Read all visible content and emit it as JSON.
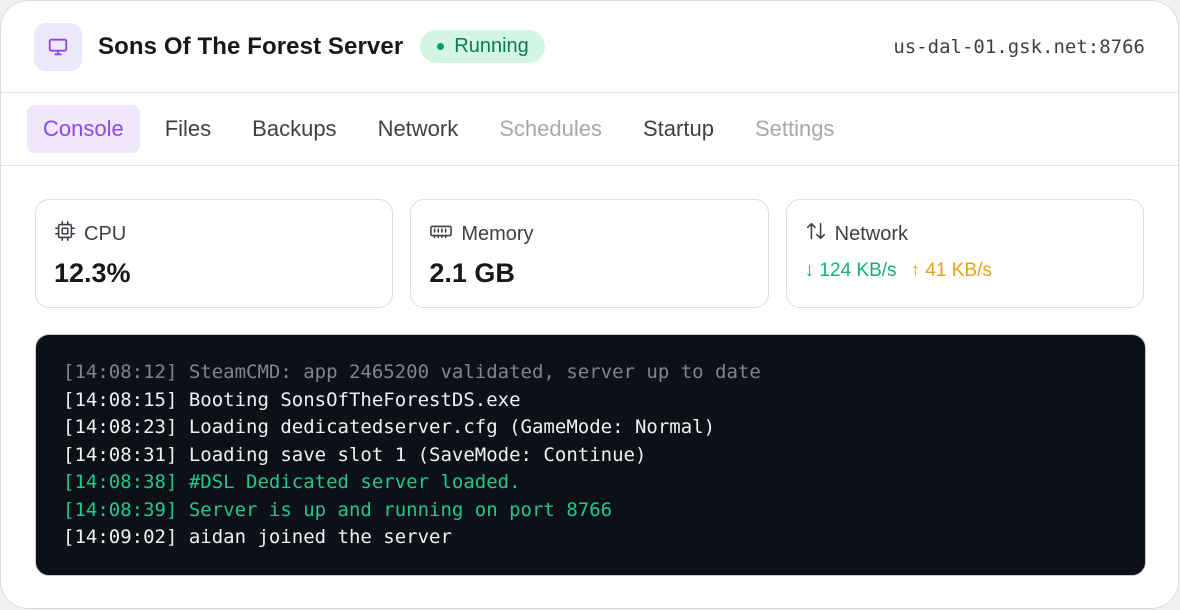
{
  "header": {
    "title": "Sons Of The Forest Server",
    "status": "Running",
    "host": "us-dal-01.gsk.net:8766",
    "icon": "monitor-icon"
  },
  "tabs": [
    {
      "label": "Console",
      "state": "active"
    },
    {
      "label": "Files",
      "state": "normal"
    },
    {
      "label": "Backups",
      "state": "normal"
    },
    {
      "label": "Network",
      "state": "normal"
    },
    {
      "label": "Schedules",
      "state": "disabled"
    },
    {
      "label": "Startup",
      "state": "normal"
    },
    {
      "label": "Settings",
      "state": "disabled"
    }
  ],
  "stats": {
    "cpu": {
      "label": "CPU",
      "value": "12.3%",
      "icon": "cpu-icon"
    },
    "memory": {
      "label": "Memory",
      "value": "2.1 GB",
      "icon": "memory-icon"
    },
    "network": {
      "label": "Network",
      "down": "↓ 124 KB/s",
      "up": "↑ 41 KB/s",
      "icon": "arrows-up-down-icon"
    }
  },
  "console": {
    "lines": [
      {
        "text": "[14:08:12] SteamCMD: app 2465200 validated, server up to date",
        "tone": "muted"
      },
      {
        "text": "[14:08:15] Booting SonsOfTheForestDS.exe",
        "tone": "normal"
      },
      {
        "text": "[14:08:23] Loading dedicatedserver.cfg (GameMode: Normal)",
        "tone": "normal"
      },
      {
        "text": "[14:08:31] Loading save slot 1 (SaveMode: Continue)",
        "tone": "normal"
      },
      {
        "text": "[14:08:38] #DSL Dedicated server loaded.",
        "tone": "success"
      },
      {
        "text": "[14:08:39] Server is up and running on port 8766",
        "tone": "success"
      },
      {
        "text": "[14:09:02] aidan joined the server",
        "tone": "normal"
      }
    ]
  },
  "colors": {
    "accent": "#8d49e6",
    "status_bg": "#d3f5e4",
    "status_text": "#0b7d4c",
    "console_bg": "#0d1117",
    "success": "#1fc98a",
    "warning": "#e9a012"
  }
}
